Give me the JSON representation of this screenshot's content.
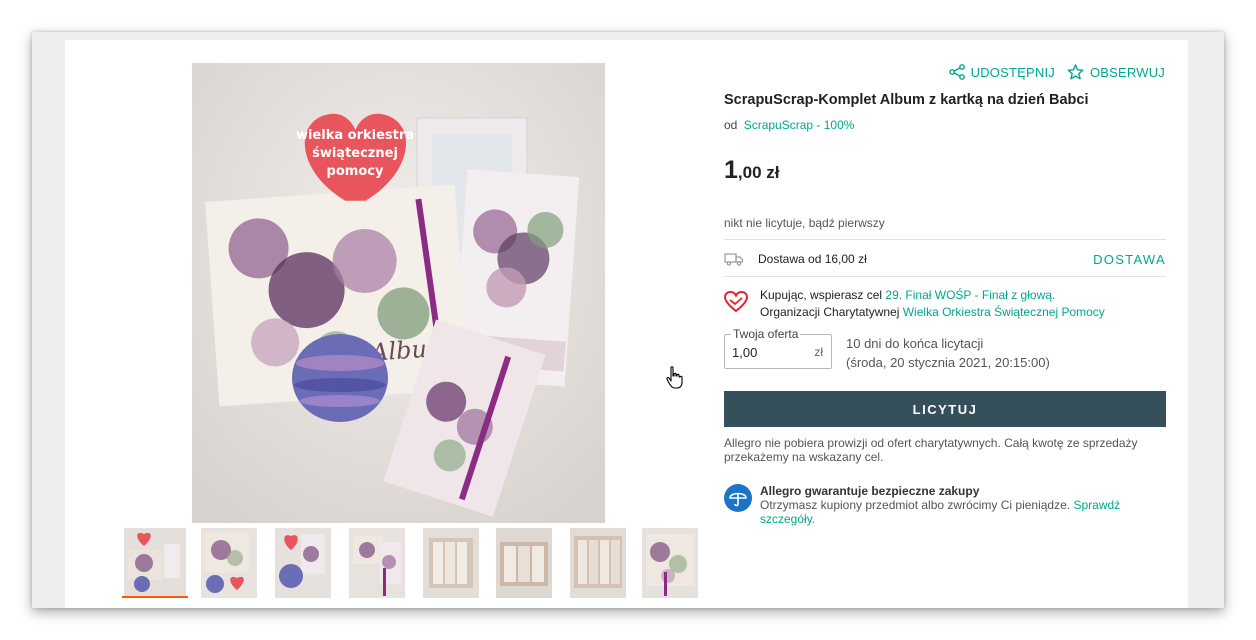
{
  "actions": {
    "share": "UDOSTĘPNIJ",
    "watch": "OBSERWUJ"
  },
  "product": {
    "title": "ScrapuScrap-Komplet Album z kartką na dzień Babci",
    "seller_prefix": "od",
    "seller": "ScrapuScrap - 100%",
    "price_main": "1",
    "price_rest": ",00 zł",
    "bids_note": "nikt nie licytuje, bądź pierwszy"
  },
  "delivery": {
    "text": "Dostawa od 16,00 zł",
    "link": "DOSTAWA"
  },
  "charity": {
    "line1_prefix": "Kupując, wspierasz cel",
    "line1_link": "29. Finał WOŚP - Finał z głową.",
    "line2_prefix": "Organizacji Charytatywnej",
    "line2_link": "Wielka Orkiestra Świątecznej Pomocy"
  },
  "offer": {
    "legend": "Twoja oferta",
    "value": "1,00",
    "currency": "zł"
  },
  "auction": {
    "time_left": "10 dni do końca licytacji",
    "end_date": "(środa, 20 stycznia 2021, 20:15:00)"
  },
  "bid_button": "LICYTUJ",
  "note": "Allegro nie pobiera prowizji od ofert charytatywnych. Całą kwotę ze sprzedaży przekażemy na wskazany cel.",
  "guarantee": {
    "title": "Allegro gwarantuje bezpieczne zakupy",
    "text": "Otrzymasz kupiony przedmiot albo zwrócimy Ci pieniądze.",
    "link": "Sprawdź szczegóły."
  },
  "image": {
    "heart_text": [
      "wielka orkiestra",
      "świątecznej",
      "pomocy"
    ],
    "album_text": "Album"
  },
  "thumbnails": [
    "photo-1",
    "photo-2",
    "photo-3",
    "photo-4",
    "photo-5",
    "photo-6",
    "photo-7",
    "photo-8",
    "photo-9"
  ],
  "colors": {
    "accent": "#00a790",
    "button": "#35505b",
    "active_thumb": "#ff5a00",
    "heart": "#e9555c",
    "guarantee": "#1b74c5"
  }
}
